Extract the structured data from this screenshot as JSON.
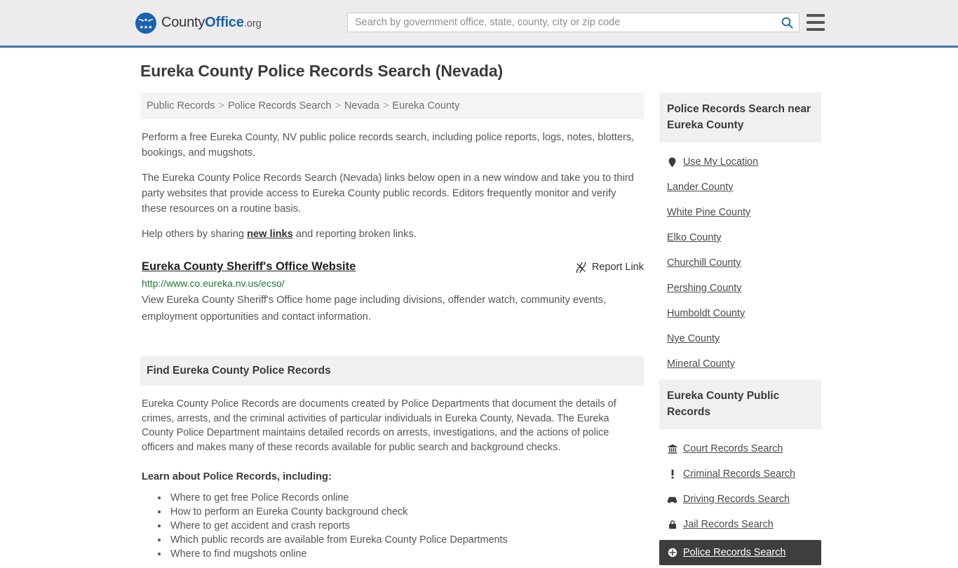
{
  "header": {
    "brand": {
      "part1": "County",
      "part2": "Office",
      "part3": ".org"
    },
    "search": {
      "placeholder": "Search by government office, state, county, city or zip code",
      "value": ""
    },
    "search_icon": "search-icon",
    "menu_icon": "hamburger-menu-icon"
  },
  "page": {
    "title": "Eureka County Police Records Search (Nevada)"
  },
  "breadcrumb": {
    "items": [
      {
        "label": "Public Records"
      },
      {
        "label": "Police Records Search"
      },
      {
        "label": "Nevada"
      },
      {
        "label": "Eureka County"
      }
    ],
    "separator": ">"
  },
  "intro": {
    "p1": "Perform a free Eureka County, NV public police records search, including police reports, logs, notes, blotters, bookings, and mugshots.",
    "p2": "The Eureka County Police Records Search (Nevada) links below open in a new window and take you to third party websites that provide access to Eureka County public records. Editors frequently monitor and verify these resources on a routine basis.",
    "p3_before": "Help others by sharing ",
    "p3_link": "new links",
    "p3_after": " and reporting broken links."
  },
  "result": {
    "title": "Eureka County Sheriff's Office Website",
    "report_label": "Report Link",
    "report_icon": "broken-link-icon",
    "url": "http://www.co.eureka.nv.us/ecso/",
    "description": "View Eureka County Sheriff's Office home page including divisions, offender watch, community events, employment opportunities and contact information."
  },
  "section": {
    "heading": "Find Eureka County Police Records",
    "paragraph": "Eureka County Police Records are documents created by Police Departments that document the details of crimes, arrests, and the criminal activities of particular individuals in Eureka County, Nevada. The Eureka County Police Department maintains detailed records on arrests, investigations, and the actions of police officers and makes many of these records available for public search and background checks.",
    "learn_heading": "Learn about Police Records, including:",
    "bullets": [
      "Where to get free Police Records online",
      "How to perform an Eureka County background check",
      "Where to get accident and crash reports",
      "Which public records are available from Eureka County Police Departments",
      "Where to find mugshots online"
    ]
  },
  "sidebar": {
    "nearby": {
      "heading": "Police Records Search near Eureka County",
      "items": [
        {
          "label": "Use My Location",
          "icon": "map-pin-icon"
        },
        {
          "label": "Lander County",
          "icon": ""
        },
        {
          "label": "White Pine County",
          "icon": ""
        },
        {
          "label": "Elko County",
          "icon": ""
        },
        {
          "label": "Churchill County",
          "icon": ""
        },
        {
          "label": "Pershing County",
          "icon": ""
        },
        {
          "label": "Humboldt County",
          "icon": ""
        },
        {
          "label": "Nye County",
          "icon": ""
        },
        {
          "label": "Mineral County",
          "icon": ""
        }
      ]
    },
    "public_records": {
      "heading": "Eureka County Public Records",
      "items": [
        {
          "label": "Court Records Search",
          "icon": "courthouse-icon",
          "active": false
        },
        {
          "label": "Criminal Records Search",
          "icon": "exclamation-icon",
          "active": false
        },
        {
          "label": "Driving Records Search",
          "icon": "car-icon",
          "active": false
        },
        {
          "label": "Jail Records Search",
          "icon": "padlock-icon",
          "active": false
        },
        {
          "label": "Police Records Search",
          "icon": "police-badge-icon",
          "active": true
        }
      ]
    }
  },
  "colors": {
    "brand_blue": "#1b62ad",
    "header_border": "#4179ac",
    "header_bg": "#ececec",
    "panel_bg": "#f0f0f0",
    "url_green": "#1d7a33",
    "active_bg": "#3e3e3e"
  }
}
